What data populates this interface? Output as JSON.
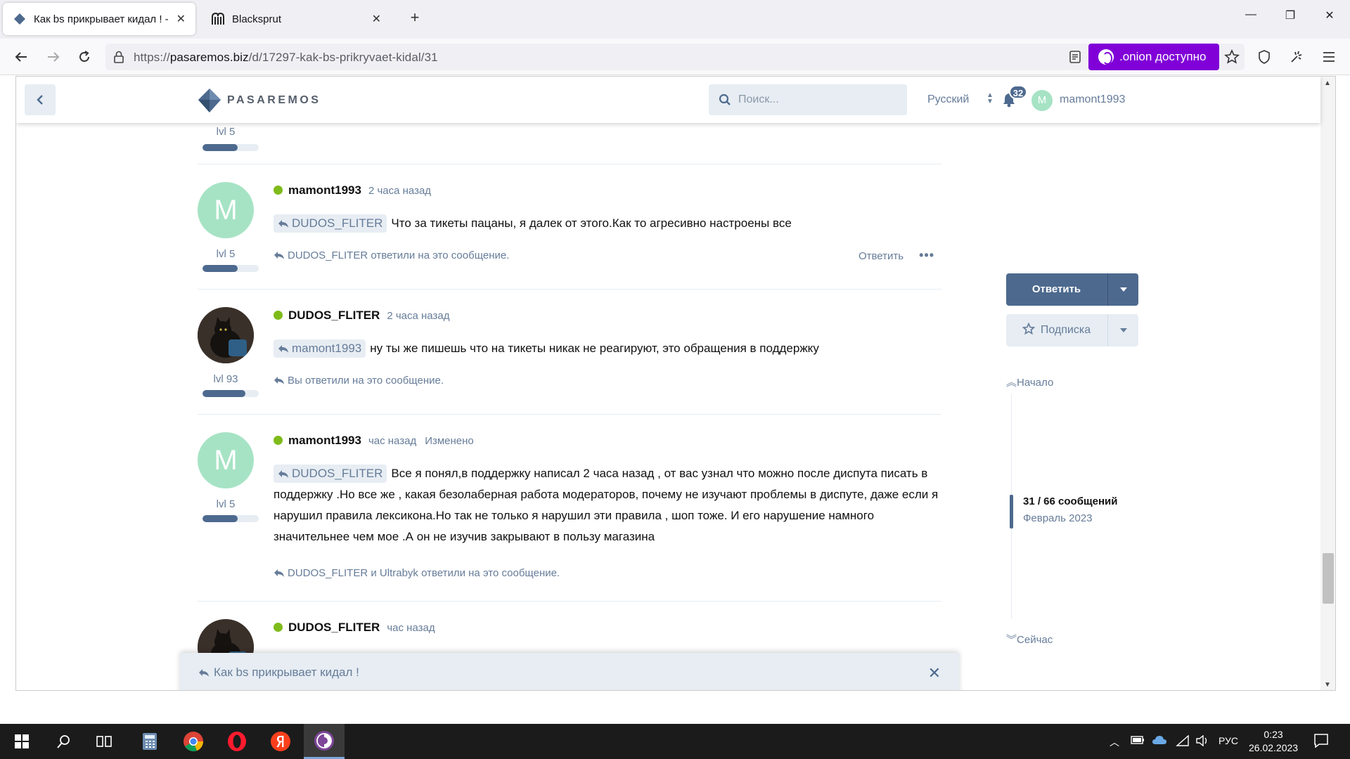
{
  "browser": {
    "tabs": [
      {
        "title": "Как bs прикрывает кидал ! - |P",
        "active": true
      },
      {
        "title": "Blacksprut",
        "active": false
      }
    ],
    "url_prefix": "https://",
    "url_domain": "pasaremos.biz",
    "url_path": "/d/17297-kak-bs-prikryvaet-kidal/31",
    "onion_label": ".onion доступно"
  },
  "site": {
    "logo_text": "PASAREMOS",
    "search_placeholder": "Поиск...",
    "language": "Русский",
    "notifications": "32",
    "user_initial": "M",
    "username": "mamont1993"
  },
  "posts": [
    {
      "top_level": "lvl 5",
      "top_level_progress": 0.62
    },
    {
      "avatar_initial": "M",
      "author": "mamont1993",
      "time": "2 часа назад",
      "mention": "DUDOS_FLITER",
      "text": "Что за тикеты пацаны, я далек от этого.Как то агресивно настроены все",
      "level": "lvl 5",
      "level_progress": 0.62,
      "replied": "DUDOS_FLITER ответили на это сообщение.",
      "reply_action": "Ответить",
      "more": "•••"
    },
    {
      "author": "DUDOS_FLITER",
      "time": "2 часа назад",
      "mention": "mamont1993",
      "text": "ну ты же пишешь что на тикеты никак не реагируют, это обращения в поддержку",
      "level": "lvl 93",
      "level_progress": 0.76,
      "replied": "Вы ответили на это сообщение."
    },
    {
      "avatar_initial": "M",
      "author": "mamont1993",
      "time": "час назад",
      "edited": "Изменено",
      "mention": "DUDOS_FLITER",
      "text": "Все я понял,в поддержку написал 2 часа назад , от вас узнал что можно после диспута писать в поддержку .Но все же , какая безолаберная работа модераторов, почему не изучают проблемы в диспуте, даже если я нарушил правила лексикона.Но так не только я нарушил эти правила , шоп тоже. И его нарушение намного значительнее чем мое .А он не изучив закрывают в пользу магазина",
      "level": "lvl 5",
      "level_progress": 0.62,
      "replied": "DUDOS_FLITER и Ultrabyk ответили на это сообщение."
    },
    {
      "author": "DUDOS_FLITER",
      "time": "час назад"
    }
  ],
  "sidebar": {
    "reply_button": "Ответить",
    "subscribe_button": "Подписка",
    "scrub_start": "Начало",
    "scrub_count": "31 / 66 сообщений",
    "scrub_date": "Февраль 2023",
    "scrub_now": "Сейчас"
  },
  "composer": {
    "title": "Как bs прикрывает кидал !"
  },
  "taskbar": {
    "lang": "РУС",
    "time": "0:23",
    "date": "26.02.2023"
  },
  "colors": {
    "primary": "#4d698e",
    "muted": "#667c99",
    "online": "#7fbb1a",
    "avatar_green": "#a6e3c4",
    "tor_purple": "#8000d7"
  }
}
